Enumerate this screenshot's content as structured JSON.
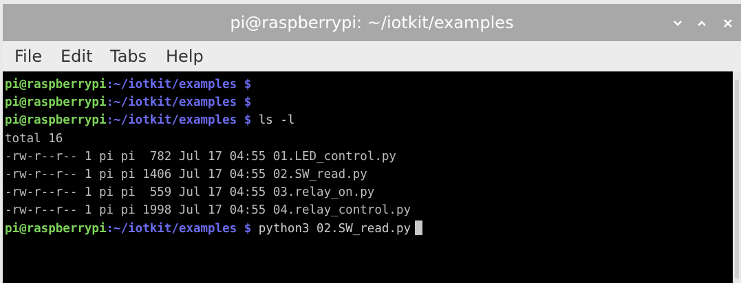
{
  "window": {
    "title": "pi@raspberrypi: ~/iotkit/examples",
    "controls": {
      "minimize_icon": "chevron-down-icon",
      "maximize_icon": "chevron-up-icon",
      "close_icon": "close-icon"
    }
  },
  "menubar": {
    "items": [
      "File",
      "Edit",
      "Tabs",
      "Help"
    ]
  },
  "colors": {
    "titlebar": "#a8a8a8",
    "terminal_bg": "#000000",
    "prompt_user": "#7fd55a",
    "prompt_path": "#6c6cf0",
    "text": "#bdbdbd"
  },
  "terminal": {
    "prompt_user": "pi@raspberrypi",
    "prompt_path": ":~/iotkit/examples $",
    "lines": [
      {
        "type": "prompt",
        "command": ""
      },
      {
        "type": "prompt",
        "command": ""
      },
      {
        "type": "prompt",
        "command": "ls -l"
      },
      {
        "type": "output",
        "text": "total 16"
      },
      {
        "type": "output",
        "text": "-rw-r--r-- 1 pi pi  782 Jul 17 04:55 01.LED_control.py"
      },
      {
        "type": "output",
        "text": "-rw-r--r-- 1 pi pi 1406 Jul 17 04:55 02.SW_read.py"
      },
      {
        "type": "output",
        "text": "-rw-r--r-- 1 pi pi  559 Jul 17 04:55 03.relay_on.py"
      },
      {
        "type": "output",
        "text": "-rw-r--r-- 1 pi pi 1998 Jul 17 04:55 04.relay_control.py"
      },
      {
        "type": "prompt",
        "command": "python3 02.SW_read.py"
      }
    ]
  }
}
